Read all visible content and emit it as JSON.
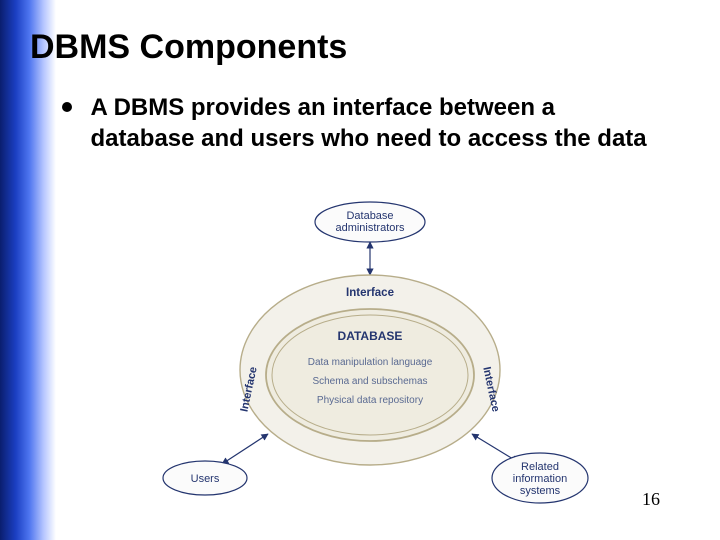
{
  "slide": {
    "title": "DBMS Components",
    "bullet": "A DBMS provides an interface between a database and users who need to access the data",
    "page_number": "16"
  },
  "diagram": {
    "top_node": {
      "line1": "Database",
      "line2": "administrators"
    },
    "outer_ring_label": "Interface",
    "center": {
      "title": "DATABASE",
      "line1": "Data manipulation language",
      "line2": "Schema and subschemas",
      "line3": "Physical data repository"
    },
    "side_label_left": "Interface",
    "side_label_right": "Interface",
    "bottom_left_node": "Users",
    "bottom_right_node": {
      "line1": "Related",
      "line2": "information",
      "line3": "systems"
    }
  }
}
